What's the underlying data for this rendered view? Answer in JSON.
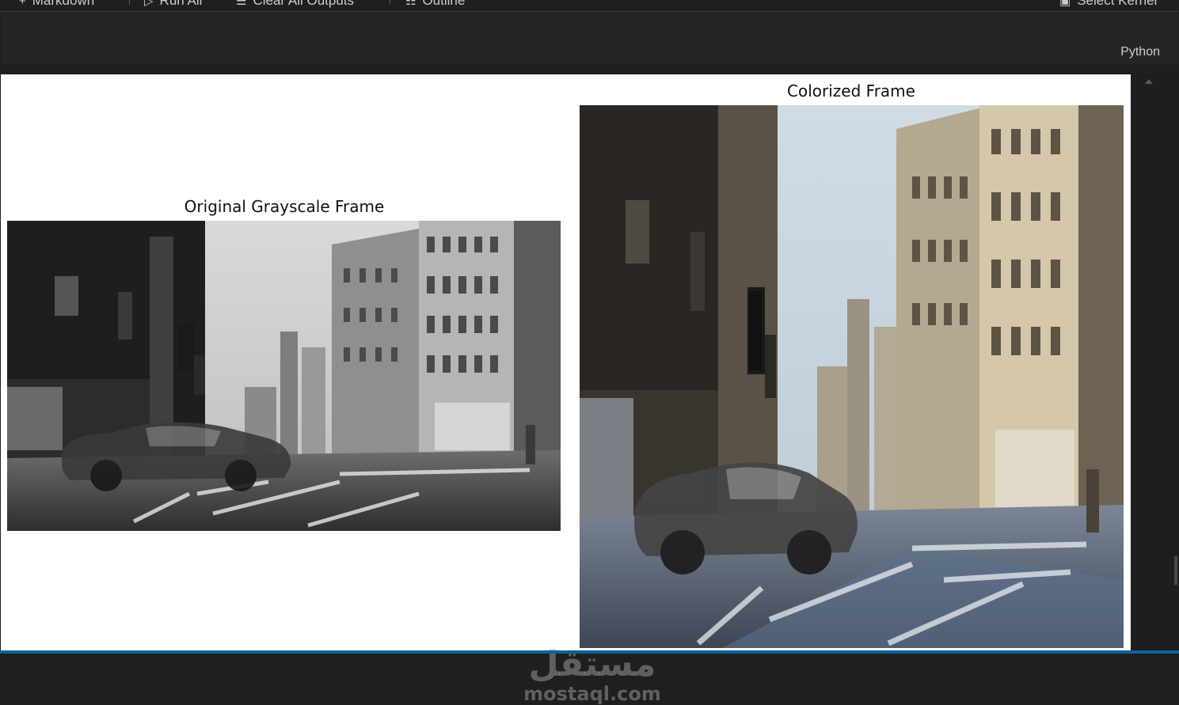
{
  "toolbar": {
    "items": [
      {
        "icon": "plus-icon",
        "label": "Markdown"
      },
      {
        "icon": "run-all-icon",
        "label": "Run All"
      },
      {
        "icon": "clear-outputs-icon",
        "label": "Clear All Outputs"
      },
      {
        "icon": "outline-icon",
        "label": "Outline"
      }
    ],
    "kernel": {
      "icon": "kernel-icon",
      "label": "Select Kernel"
    }
  },
  "cell": {
    "language": "Python"
  },
  "output": {
    "left_title": "Original Grayscale Frame",
    "right_title": "Colorized Frame"
  },
  "watermark": {
    "arabic": "مستقل",
    "latin": "mostaql.com"
  },
  "colors": {
    "editor_bg": "#1f1f1f",
    "cell_bg": "#252526",
    "output_bg": "#ffffff",
    "accent": "#0e639c"
  }
}
